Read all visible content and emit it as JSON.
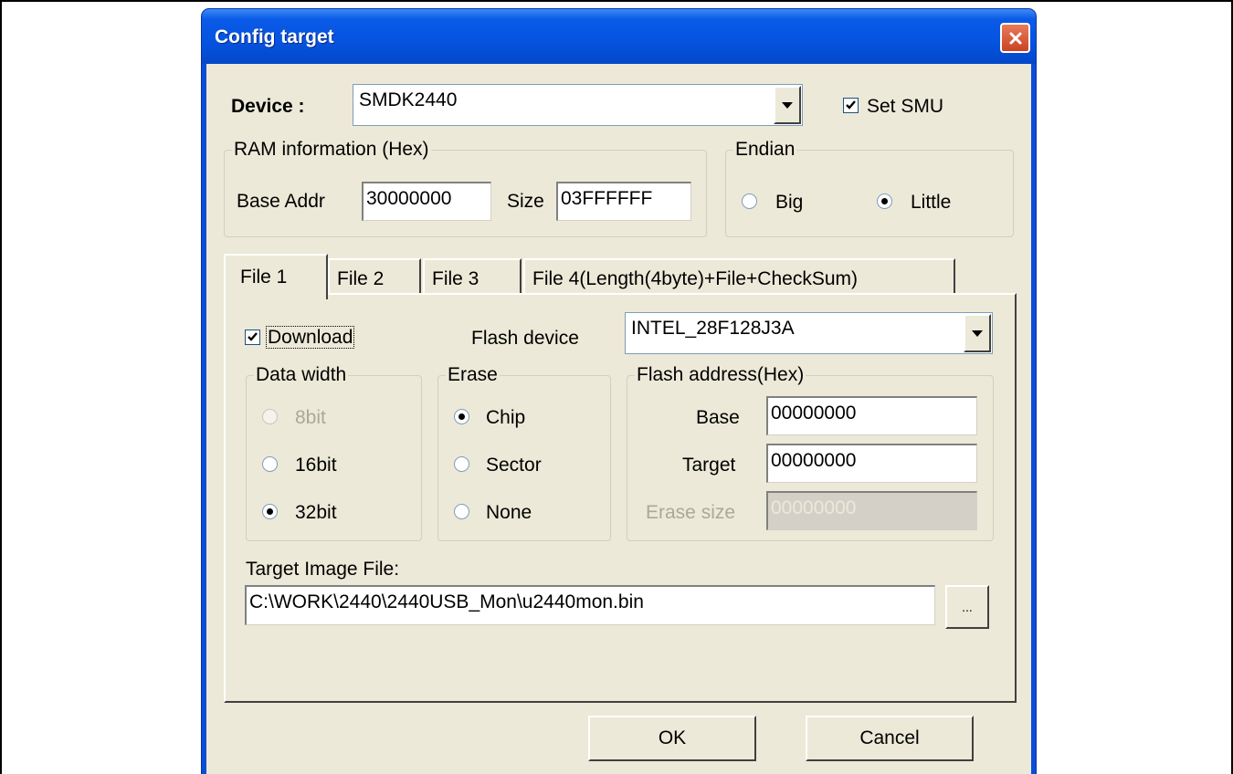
{
  "window": {
    "title": "Config target"
  },
  "device": {
    "label": "Device :",
    "value": "SMDK2440"
  },
  "set_smu": {
    "label": "Set SMU",
    "checked": true
  },
  "ram": {
    "caption": "RAM information (Hex)",
    "base_label": "Base Addr",
    "base_value": "30000000",
    "size_label": "Size",
    "size_value": "03FFFFFF"
  },
  "endian": {
    "caption": "Endian",
    "options": [
      "Big",
      "Little"
    ],
    "selected": "Little"
  },
  "tabs": [
    {
      "label": "File 1",
      "active": true
    },
    {
      "label": "File 2",
      "active": false
    },
    {
      "label": "File 3",
      "active": false
    },
    {
      "label": "File 4(Length(4byte)+File+CheckSum)",
      "active": false
    }
  ],
  "file1": {
    "download": {
      "label": "Download",
      "checked": true
    },
    "flash_device": {
      "label": "Flash device",
      "value": "INTEL_28F128J3A"
    },
    "data_width": {
      "caption": "Data width",
      "options": [
        "8bit",
        "16bit",
        "32bit"
      ],
      "selected": "32bit",
      "disabled": [
        "8bit"
      ]
    },
    "erase": {
      "caption": "Erase",
      "options": [
        "Chip",
        "Sector",
        "None"
      ],
      "selected": "Chip"
    },
    "flash_address": {
      "caption": "Flash address(Hex)",
      "base_label": "Base",
      "base_value": "00000000",
      "target_label": "Target",
      "target_value": "00000000",
      "erase_size_label": "Erase size",
      "erase_size_value": "00000000"
    },
    "target_image": {
      "label": "Target Image File:",
      "path": "C:\\WORK\\2440\\2440USB_Mon\\u2440mon.bin",
      "browse_label": "..."
    }
  },
  "buttons": {
    "ok": "OK",
    "cancel": "Cancel"
  },
  "colors": {
    "titlebar": "#0553e0",
    "dialog_bg": "#ece9d8",
    "close_button": "#c94322"
  }
}
